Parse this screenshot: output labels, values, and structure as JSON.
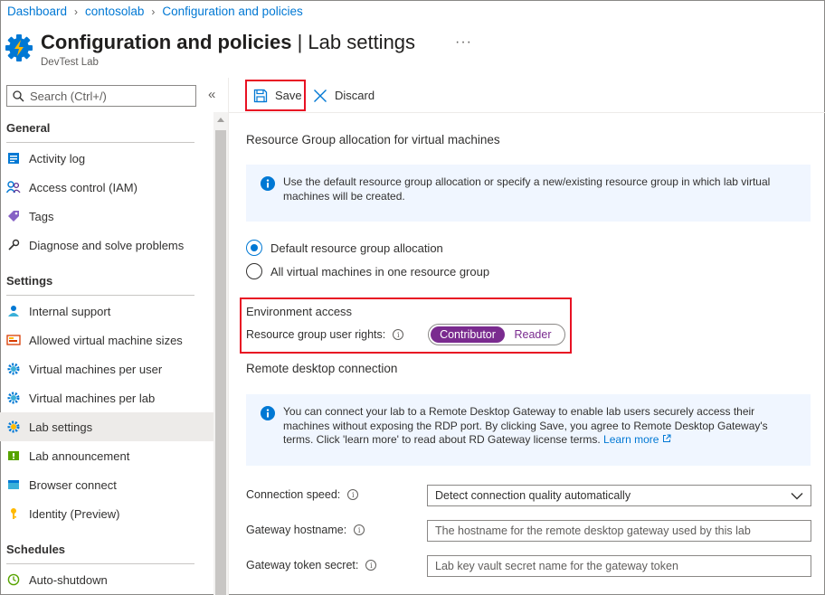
{
  "breadcrumb": [
    "Dashboard",
    "contosolab",
    "Configuration and policies"
  ],
  "header": {
    "title": "Configuration and policies",
    "title_sep": " | ",
    "title_sub": "Lab settings",
    "subtitle": "DevTest Lab",
    "more": "···"
  },
  "sidebar": {
    "search_placeholder": "Search (Ctrl+/)",
    "collapse": "«",
    "sections": [
      {
        "heading": "General",
        "items": [
          {
            "label": "Activity log",
            "icon": "activity-log-icon"
          },
          {
            "label": "Access control (IAM)",
            "icon": "people-icon"
          },
          {
            "label": "Tags",
            "icon": "tag-icon"
          },
          {
            "label": "Diagnose and solve problems",
            "icon": "wrench-icon"
          }
        ]
      },
      {
        "heading": "Settings",
        "items": [
          {
            "label": "Internal support",
            "icon": "support-person-icon"
          },
          {
            "label": "Allowed virtual machine sizes",
            "icon": "vm-sizes-icon"
          },
          {
            "label": "Virtual machines per user",
            "icon": "gear-icon"
          },
          {
            "label": "Virtual machines per lab",
            "icon": "gear-icon"
          },
          {
            "label": "Lab settings",
            "icon": "gear-icon",
            "active": true
          },
          {
            "label": "Lab announcement",
            "icon": "announcement-icon"
          },
          {
            "label": "Browser connect",
            "icon": "browser-icon"
          },
          {
            "label": "Identity (Preview)",
            "icon": "key-icon"
          }
        ]
      },
      {
        "heading": "Schedules",
        "items": [
          {
            "label": "Auto-shutdown",
            "icon": "clock-icon"
          }
        ]
      }
    ]
  },
  "toolbar": {
    "save": "Save",
    "discard": "Discard"
  },
  "main": {
    "rg_heading": "Resource Group allocation for virtual machines",
    "rg_info": "Use the default resource group allocation or specify a new/existing resource group in which lab virtual machines will be created.",
    "radio_default": "Default resource group allocation",
    "radio_single": "All virtual machines in one resource group",
    "env_heading": "Environment access",
    "rights_label": "Resource group user rights:",
    "toggle_on": "Contributor",
    "toggle_off": "Reader",
    "rdp_heading": "Remote desktop connection",
    "rdp_info": "You can connect your lab to a Remote Desktop Gateway to enable lab users securely access their machines without exposing the RDP port. By clicking Save, you agree to Remote Desktop Gateway's terms.  Click 'learn more' to read about RD Gateway license terms. ",
    "rdp_link": "Learn more",
    "speed_label": "Connection speed:",
    "speed_value": "Detect connection quality automatically",
    "host_label": "Gateway hostname:",
    "host_placeholder": "The hostname for the remote desktop gateway used by this lab",
    "token_label": "Gateway token secret:",
    "token_placeholder": "Lab key vault secret name for the gateway token"
  },
  "colors": {
    "accent": "#0078d4",
    "highlight": "#e81123",
    "toggle": "#7a2b8f"
  }
}
